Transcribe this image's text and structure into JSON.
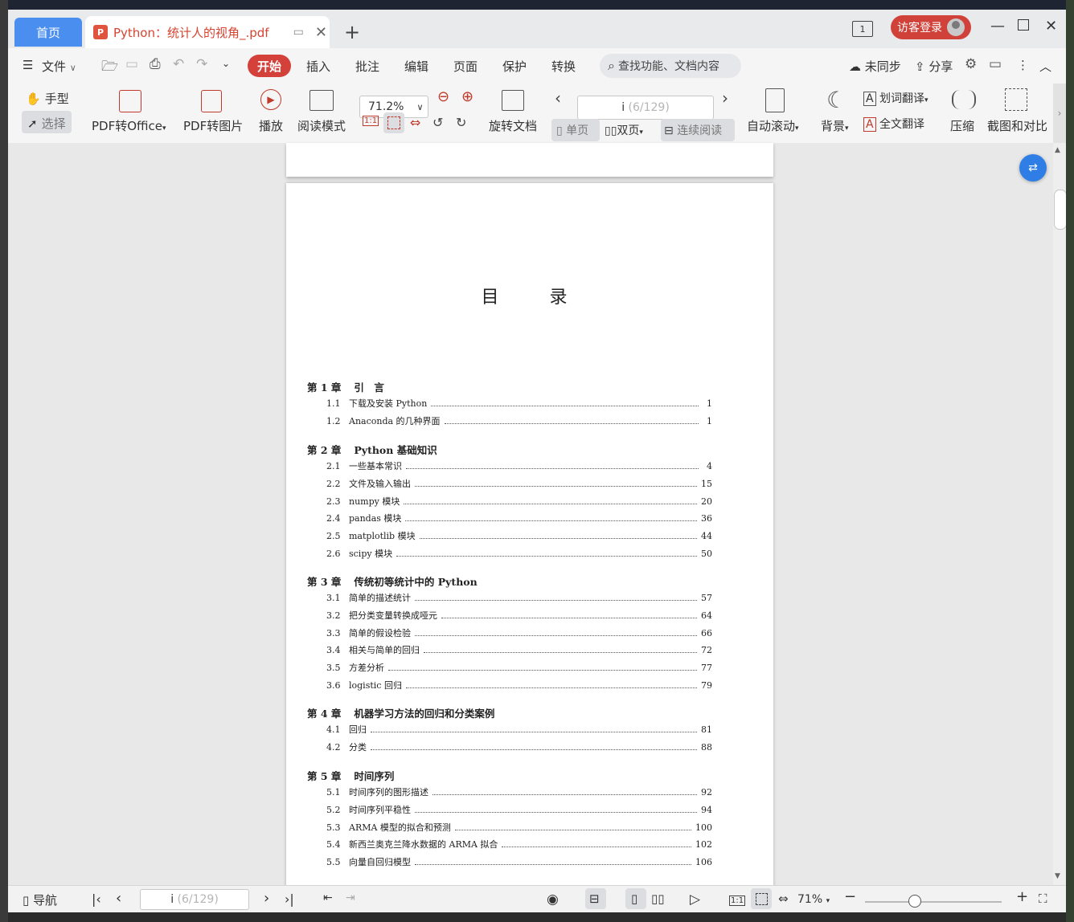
{
  "window": {
    "home_tab": "首页",
    "doc_tab": "Python：统计人的视角_.pdf",
    "doc_tab_icon": "pdf-icon",
    "page_count_badge": "1",
    "login_label": "访客登录"
  },
  "menu": {
    "file": "文件",
    "items": [
      "开始",
      "插入",
      "批注",
      "编辑",
      "页面",
      "保护",
      "转换"
    ],
    "active": "开始",
    "search_placeholder": "查找功能、文档内容",
    "sync": "未同步",
    "share": "分享"
  },
  "ribbon": {
    "hand": "手型",
    "select": "选择",
    "pdf_to_office": "PDF转Office",
    "pdf_to_image": "PDF转图片",
    "play": "播放",
    "read_mode": "阅读模式",
    "zoom": "71.2%",
    "rotate": "旋转文档",
    "page_input": "i",
    "page_total": "(6/129)",
    "single": "单页",
    "double": "双页",
    "continuous": "连续阅读",
    "auto_scroll": "自动滚动",
    "background": "背景",
    "word_translate": "划词翻译",
    "full_translate": "全文翻译",
    "compress": "压缩",
    "screenshot_compare": "截图和对比"
  },
  "document": {
    "title": "目 录",
    "chapters": [
      {
        "label": "第 1 章",
        "title": "引　言",
        "entries": [
          {
            "num": "1.1",
            "title": "下载及安装 Python",
            "page": "1"
          },
          {
            "num": "1.2",
            "title": "Anaconda 的几种界面",
            "page": "1"
          }
        ]
      },
      {
        "label": "第 2 章",
        "title": "Python 基础知识",
        "entries": [
          {
            "num": "2.1",
            "title": "一些基本常识",
            "page": "4"
          },
          {
            "num": "2.2",
            "title": "文件及输入输出",
            "page": "15"
          },
          {
            "num": "2.3",
            "title": "numpy 模块",
            "page": "20"
          },
          {
            "num": "2.4",
            "title": "pandas 模块",
            "page": "36"
          },
          {
            "num": "2.5",
            "title": "matplotlib 模块",
            "page": "44"
          },
          {
            "num": "2.6",
            "title": "scipy 模块",
            "page": "50"
          }
        ]
      },
      {
        "label": "第 3 章",
        "title": "传统初等统计中的 Python",
        "entries": [
          {
            "num": "3.1",
            "title": "简单的描述统计",
            "page": "57"
          },
          {
            "num": "3.2",
            "title": "把分类变量转换成哑元",
            "page": "64"
          },
          {
            "num": "3.3",
            "title": "简单的假设检验",
            "page": "66"
          },
          {
            "num": "3.4",
            "title": "相关与简单的回归",
            "page": "72"
          },
          {
            "num": "3.5",
            "title": "方差分析",
            "page": "77"
          },
          {
            "num": "3.6",
            "title": "logistic 回归",
            "page": "79"
          }
        ]
      },
      {
        "label": "第 4 章",
        "title": "机器学习方法的回归和分类案例",
        "entries": [
          {
            "num": "4.1",
            "title": "回归",
            "page": "81"
          },
          {
            "num": "4.2",
            "title": "分类",
            "page": "88"
          }
        ]
      },
      {
        "label": "第 5 章",
        "title": "时间序列",
        "entries": [
          {
            "num": "5.1",
            "title": "时间序列的图形描述",
            "page": "92"
          },
          {
            "num": "5.2",
            "title": "时间序列平稳性",
            "page": "94"
          },
          {
            "num": "5.3",
            "title": "ARMA 模型的拟合和预测",
            "page": "100"
          },
          {
            "num": "5.4",
            "title": "新西兰奥克兰降水数据的 ARMA 拟合",
            "page": "102"
          },
          {
            "num": "5.5",
            "title": "向量自回归模型",
            "page": "106"
          }
        ]
      }
    ]
  },
  "statusbar": {
    "nav": "导航",
    "page_input": "i",
    "page_total": "(6/129)",
    "zoom": "71%"
  }
}
